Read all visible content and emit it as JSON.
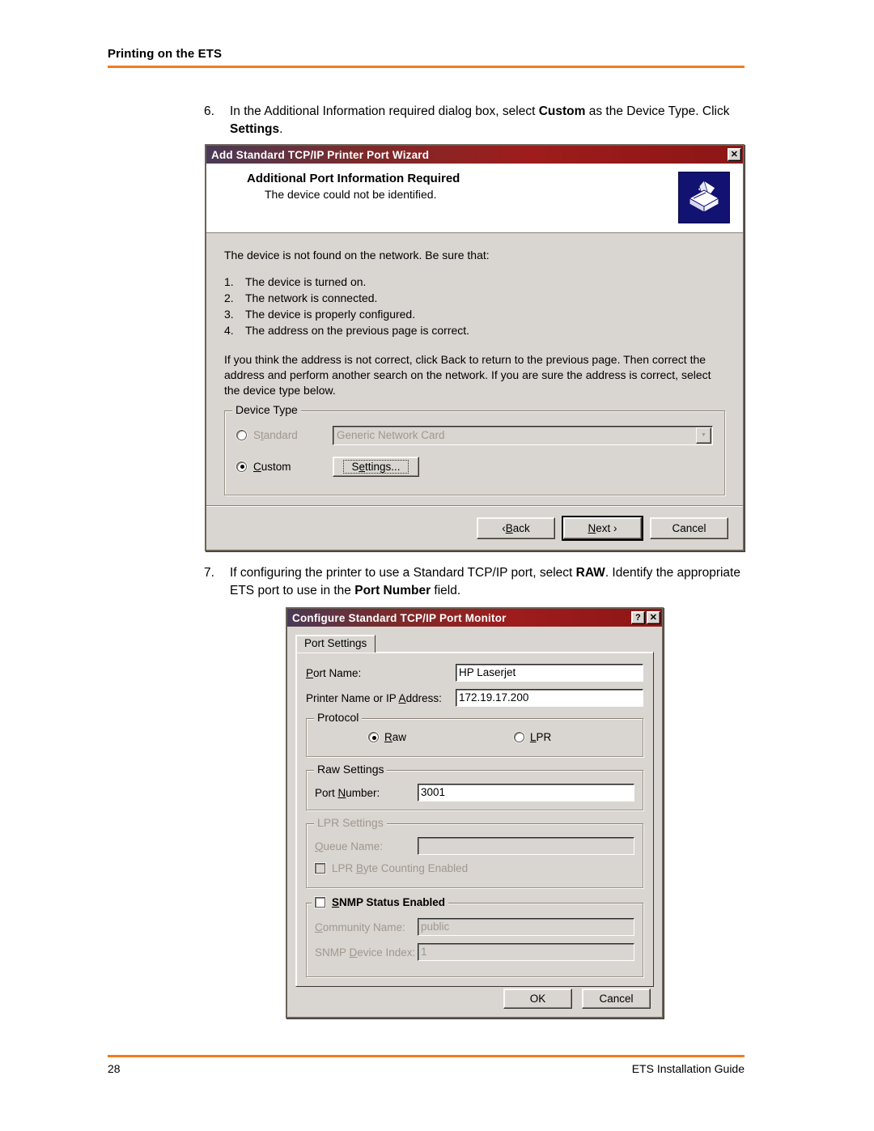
{
  "page": {
    "header_title": "Printing on the ETS",
    "page_number": "28",
    "footer_title": "ETS Installation Guide",
    "accent_color": "#F47B20"
  },
  "steps": [
    {
      "number": "6.",
      "parts": [
        {
          "text": "In the Additional Information required dialog box, select ",
          "bold": false
        },
        {
          "text": "Custom",
          "bold": true
        },
        {
          "text": " as the Device Type.  Click ",
          "bold": false
        },
        {
          "text": "Settings",
          "bold": true
        },
        {
          "text": ".",
          "bold": false
        }
      ]
    },
    {
      "number": "7.",
      "parts": [
        {
          "text": "If configuring the printer to use a Standard TCP/IP port, select ",
          "bold": false
        },
        {
          "text": "RAW",
          "bold": true
        },
        {
          "text": ".  Identify the appropriate ETS port to use in the ",
          "bold": false
        },
        {
          "text": "Port Number",
          "bold": true
        },
        {
          "text": " field.",
          "bold": false
        }
      ]
    }
  ],
  "dialog1": {
    "title": "Add Standard TCP/IP Printer Port Wizard",
    "close_label": "✕",
    "heading": "Additional Port Information Required",
    "subheading": "The device could not be identified.",
    "icon": "printer-icon",
    "intro": "The device is not found on the network.  Be sure that:",
    "checks": [
      {
        "n": "1.",
        "t": "The device is turned on."
      },
      {
        "n": "2.",
        "t": "The network is connected."
      },
      {
        "n": "3.",
        "t": "The device is properly configured."
      },
      {
        "n": "4.",
        "t": "The address on the previous page is correct."
      }
    ],
    "advice": "If you think the address is not correct, click Back to return to the previous page.  Then correct the address and perform another search on the network.  If you are sure the address is correct, select the device type below.",
    "device_type": {
      "legend": "Device Type",
      "standard_label_pre": "S",
      "standard_label_key": "t",
      "standard_label_post": "andard",
      "standard_selected": false,
      "standard_combo_value": "Generic Network Card",
      "custom_label_key": "C",
      "custom_label_post": "ustom",
      "custom_selected": true,
      "settings_button_pre": "S",
      "settings_button_key": "e",
      "settings_button_post": "ttings..."
    },
    "buttons": {
      "back_pre": "‹ ",
      "back_key": "B",
      "back_post": "ack",
      "next_key": "N",
      "next_post": "ext ›",
      "cancel": "Cancel"
    }
  },
  "dialog2": {
    "title": "Configure Standard TCP/IP Port Monitor",
    "help_label": "?",
    "close_label": "✕",
    "tab": "Port Settings",
    "port_name": {
      "label_key": "P",
      "label_post": "ort Name:",
      "value": "HP Laserjet"
    },
    "printer_address": {
      "label_pre": "Printer Name or IP ",
      "label_key": "A",
      "label_post": "ddress:",
      "value": "172.19.17.200"
    },
    "protocol": {
      "legend": "Protocol",
      "raw_key": "R",
      "raw_post": "aw",
      "raw_selected": true,
      "lpr_key": "L",
      "lpr_post": "PR",
      "lpr_selected": false
    },
    "raw_settings": {
      "legend": "Raw Settings",
      "port_number_pre": "Port ",
      "port_number_key": "N",
      "port_number_post": "umber:",
      "port_number_value": "3001"
    },
    "lpr_settings": {
      "legend": "LPR Settings",
      "enabled": false,
      "queue_name_key": "Q",
      "queue_name_post": "ueue Name:",
      "queue_name_value": "",
      "byte_counting_pre": "LPR ",
      "byte_counting_key": "B",
      "byte_counting_post": "yte Counting Enabled",
      "byte_counting_checked": false
    },
    "snmp_settings": {
      "legend_key": "S",
      "legend_post": "NMP Status Enabled",
      "checked": false,
      "community_name_key": "C",
      "community_name_post": "ommunity Name:",
      "community_name_value": "public",
      "device_index_pre": "SNMP ",
      "device_index_key": "D",
      "device_index_post": "evice Index:",
      "device_index_value": "1"
    },
    "buttons": {
      "ok": "OK",
      "cancel": "Cancel"
    }
  }
}
